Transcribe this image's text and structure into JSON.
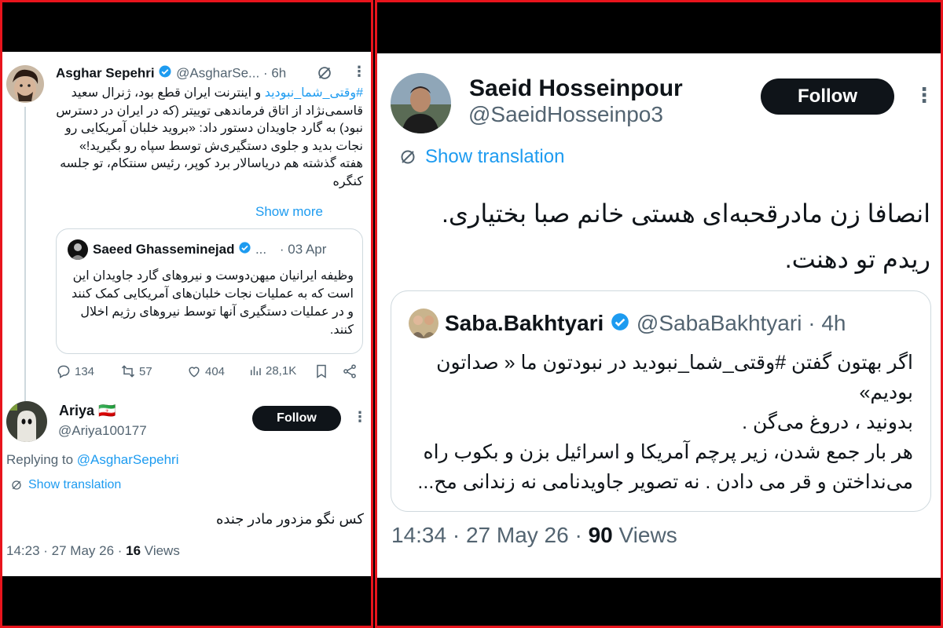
{
  "left": {
    "tweet": {
      "name": "Asghar Sepehri",
      "handle": "@AsgharSe...",
      "time": "· 6h",
      "hashtag": "#وقتی_شما_نبودید",
      "body_first": " و اینترنت ایران قطع بود، ژنرال سعید",
      "body_rest": "قاسمی‌نژاد از اتاق فرماندهی توییتر (که در ایران در دسترس نبود) به گارد جاویدان دستور داد: «بروید خلبان آمریکایی رو نجات بدید و جلوی دستگیری‌ش توسط سپاه رو بگیرید!»",
      "body_last": "هفته گذشته هم دریاسالار برد کوپر، رئیس سنتکام، تو جلسه کنگره",
      "show_more": "Show more"
    },
    "quote": {
      "name": "Saeed Ghasseminejad",
      "ellipsis": "...",
      "date": "· 03 Apr",
      "body": "وظیفه ایرانیان میهن‌دوست و نیروهای گارد جاویدان این است که به عملیات نجات خلبان‌های آمریکایی کمک کنند و در عملیات دستگیری آنها توسط نیروهای رژیم اخلال کنند."
    },
    "actions": {
      "replies": "134",
      "retweets": "57",
      "likes": "404",
      "views": "28,1K"
    },
    "reply": {
      "name": "Ariya",
      "flag": "🇮🇷",
      "handle": "@Ariya100177",
      "follow_label": "Follow",
      "replying_prefix": "Replying to ",
      "replying_handle": "@AsgharSepehri",
      "show_translation": "Show translation",
      "text": "کس نگو مزدور مادر جنده",
      "timestamp": "14:23 · 27 May 26 · ",
      "views_count": "16",
      "views_label": " Views"
    }
  },
  "right": {
    "name": "Saeid Hosseinpour",
    "handle": "@SaeidHosseinpo3",
    "follow_label": "Follow",
    "show_translation": "Show translation",
    "text": "انصافا زن مادرقحبه‌ای هستی خانم صبا بختیاری. ریدم تو دهنت.",
    "quote": {
      "name": "Saba.Bakhtyari",
      "handle": "@SabaBakhtyari",
      "time": "· 4h",
      "line1": "اگر بهتون گفتن #وقتی_شما_نبودید در نبودتون ما « صداتون بودیم»",
      "line2": "بدونید ، دروغ می‌گن .",
      "line3": "هر بار جمع شدن، زیر پرچم آمریکا و اسرائیل بزن و بکوب راه می‌نداختن و قر می دادن . نه تصویر جاویدنامی نه زندانی مح..."
    },
    "timestamp": "14:34 · 27 May 26 · ",
    "views_count": "90",
    "views_label": " Views"
  },
  "colors": {
    "accent": "#1d9bf0",
    "frame": "#e8141c",
    "text": "#0f1419",
    "muted": "#536471"
  }
}
